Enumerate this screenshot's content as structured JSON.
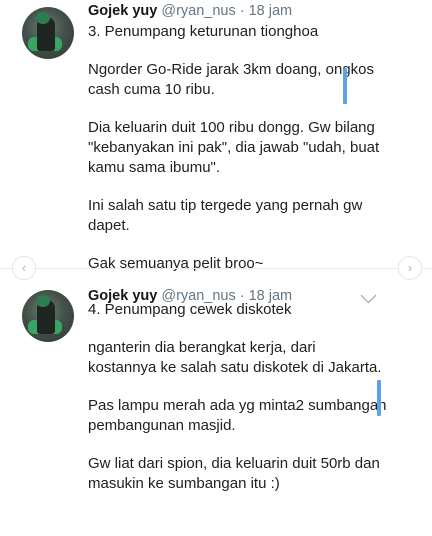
{
  "tweets": [
    {
      "name": "Gojek yuy",
      "handle": "@ryan_nus",
      "time": "· 18 jam",
      "paragraphs": [
        "3. Penumpang keturunan tionghoa",
        "Ngorder Go-Ride jarak 3km doang, ongkos cash cuma 10 ribu.",
        "Dia keluarin duit 100 ribu dongg. Gw bilang \"kebanyakan ini pak\", dia jawab \"udah, buat kamu sama ibumu\".",
        "Ini salah satu tip tergede yang pernah gw dapet.",
        "Gak semuanya pelit broo~"
      ]
    },
    {
      "name": "Gojek yuy",
      "handle": "@ryan_nus",
      "time": "· 18 jam",
      "paragraphs": [
        "4. Penumpang cewek diskotek",
        "nganterin dia berangkat kerja, dari kostannya ke salah satu diskotek di Jakarta.",
        "Pas lampu merah ada yg minta2 sumbangan pembangunan masjid.",
        "Gw liat dari spion, dia keluarin duit 50rb dan masukin ke sumbangan itu :)"
      ]
    }
  ],
  "icons": {
    "prev": "chevron-left-icon",
    "next": "chevron-right-icon",
    "menu": "chevron-down-icon"
  },
  "colors": {
    "accent": "#5aa3e6",
    "handle": "#657786"
  }
}
